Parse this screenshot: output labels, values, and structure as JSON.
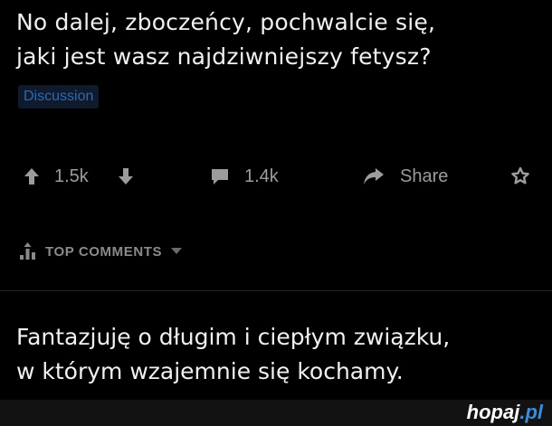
{
  "post": {
    "title_lines": [
      "No dalej, zboczeńcy, pochwalcie się,",
      "jaki jest wasz najdziwniejszy fetysz?"
    ],
    "flair": "Discussion"
  },
  "actions": {
    "upvote_count": "1.5k",
    "comment_count": "1.4k",
    "share_label": "Share",
    "icons": [
      "upvote-arrow-icon",
      "downvote-arrow-icon",
      "comment-bubble-icon",
      "share-arrow-icon",
      "award-icon"
    ]
  },
  "comments": {
    "sort_label": "TOP COMMENTS",
    "icons": [
      "sort-bars-icon",
      "caret-down-icon"
    ],
    "top_comment_lines": [
      "Fantazjuję o długim i ciepłym związku,",
      "w którym wzajemnie się kochamy."
    ]
  },
  "watermark": {
    "name": "hopaj",
    "tld": ".pl"
  },
  "colors": {
    "background": "#000000",
    "text": "#f0f0f0",
    "muted": "#9c9c9c",
    "flair_text": "#2e68b8",
    "flair_bg": "#0f1b2c",
    "watermark_accent": "#3d8bd8"
  }
}
